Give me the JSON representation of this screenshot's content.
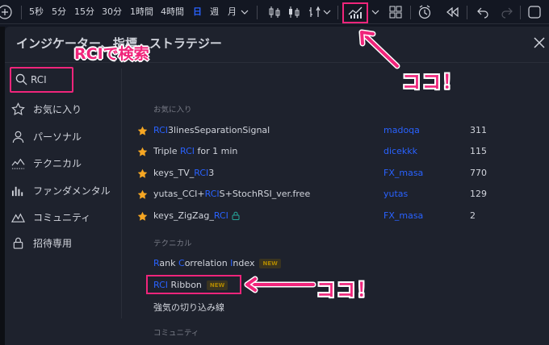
{
  "toolbar": {
    "intervals": [
      {
        "label": "5秒",
        "active": false
      },
      {
        "label": "5分",
        "active": false
      },
      {
        "label": "15分",
        "active": false
      },
      {
        "label": "30分",
        "active": false
      },
      {
        "label": "1時間",
        "active": false
      },
      {
        "label": "4時間",
        "active": false
      },
      {
        "label": "日",
        "active": true
      },
      {
        "label": "週",
        "active": false
      },
      {
        "label": "月",
        "active": false
      }
    ],
    "icons": [
      "add-icon",
      "chevron-down-icon",
      "candles-icon",
      "bar-compare-icon",
      "indicators-icon",
      "layout-icon",
      "alert-icon",
      "replay-icon",
      "undo-icon",
      "redo-icon",
      "fullscreen-icon"
    ]
  },
  "dialog": {
    "title": "インジケーター、指標、ストラテジー",
    "search": {
      "value": "RCI",
      "placeholder": ""
    }
  },
  "annotations": {
    "search_label": "RCIで検索",
    "koko_top": "ココ！",
    "koko_bottom": "ココ！",
    "color": "#f0257b"
  },
  "sidebar": {
    "items": [
      {
        "label": "お気に入り",
        "icon": "star-outline-icon"
      },
      {
        "label": "パーソナル",
        "icon": "person-icon"
      },
      {
        "label": "テクニカル",
        "icon": "chart-line-icon"
      },
      {
        "label": "ファンダメンタル",
        "icon": "bar-chart-icon"
      },
      {
        "label": "コミュニティ",
        "icon": "community-icon"
      },
      {
        "label": "招待専用",
        "icon": "lock-icon"
      }
    ]
  },
  "sections": {
    "favorites": "お気に入り",
    "technical": "テクニカル",
    "community": "コミュニティ"
  },
  "favorites": [
    {
      "pre": "",
      "hl": "RCI",
      "post": "3linesSeparationSignal",
      "author": "madoqa",
      "count": "311",
      "locked": false
    },
    {
      "pre": "Triple ",
      "hl": "RCI",
      "post": " for 1 min",
      "author": "dicekkk",
      "count": "115",
      "locked": false
    },
    {
      "pre": "keys_TV_",
      "hl": "RCI",
      "post": "3",
      "author": "FX_masa",
      "count": "770",
      "locked": false
    },
    {
      "pre": "yutas_CCI+",
      "hl": "RCI",
      "post": "S+StochRSI_ver.free",
      "author": "yutas",
      "count": "129",
      "locked": false
    },
    {
      "pre": "keys_ZigZag_",
      "hl": "RCI",
      "post": "",
      "author": "FX_masa",
      "count": "2",
      "locked": true
    }
  ],
  "technical": {
    "rank": {
      "r": "R",
      "ank": "ank ",
      "c": "C",
      "orrelation": "orrelation ",
      "i": "I",
      "ndex": "ndex",
      "badge": "NEW"
    },
    "ribbon": {
      "hl": "RCI",
      "post": " Ribbon",
      "badge": "NEW"
    },
    "kirikomi": "強気の切り込み線"
  }
}
